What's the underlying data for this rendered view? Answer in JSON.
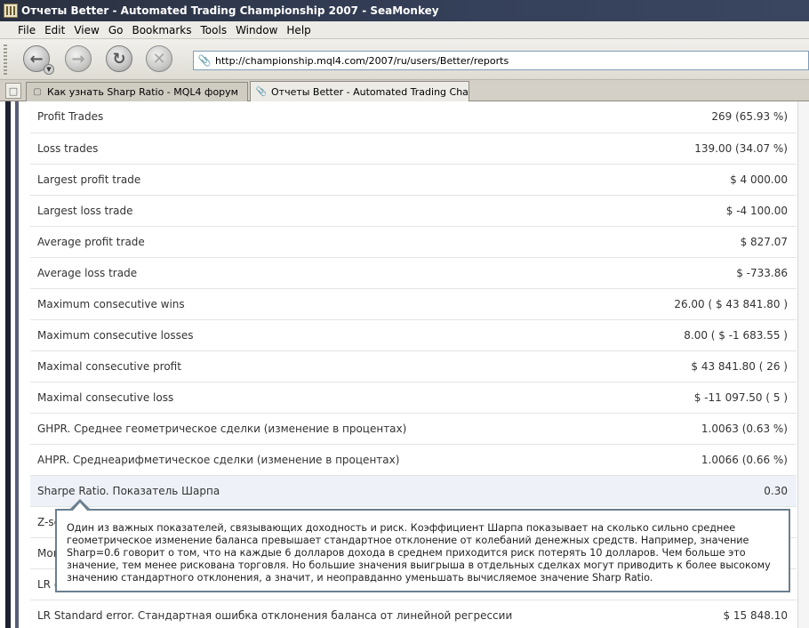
{
  "window": {
    "title": "Отчеты Better - Automated Trading Championship 2007 - SeaMonkey"
  },
  "menu": [
    "File",
    "Edit",
    "View",
    "Go",
    "Bookmarks",
    "Tools",
    "Window",
    "Help"
  ],
  "nav": {
    "back_icon": "back-arrow-icon",
    "forward_icon": "forward-arrow-icon",
    "reload_icon": "reload-icon",
    "stop_icon": "stop-icon",
    "url": "http://championship.mql4.com/2007/ru/users/Better/reports"
  },
  "tabs": [
    {
      "label": "Как узнать Sharp Ratio - MQL4 форум",
      "active": false
    },
    {
      "label": "Отчеты Better - Automated Trading Cham...",
      "active": true
    }
  ],
  "stats": [
    {
      "label": "Profit Trades",
      "value": "269 (65.93 %)"
    },
    {
      "label": "Loss trades",
      "value": "139.00 (34.07 %)"
    },
    {
      "label": "Largest profit trade",
      "value": "$ 4 000.00"
    },
    {
      "label": "Largest loss trade",
      "value": "$ -4 100.00"
    },
    {
      "label": "Average profit trade",
      "value": "$ 827.07"
    },
    {
      "label": "Average loss trade",
      "value": "$ -733.86"
    },
    {
      "label": "Maximum consecutive wins",
      "value": "26.00 ( $ 43 841.80 )"
    },
    {
      "label": "Maximum consecutive losses",
      "value": "8.00 ( $ -1 683.55 )"
    },
    {
      "label": "Maximal consecutive profit",
      "value": "$ 43 841.80 ( 26 )"
    },
    {
      "label": "Maximal consecutive loss",
      "value": "$ -11 097.50 ( 5 )"
    },
    {
      "label": "GHPR. Среднее геометрическое сделки (изменение в процентах)",
      "value": "1.0063 (0.63 %)"
    },
    {
      "label": "AHPR. Среднеарифметическое сделки (изменение в процентах)",
      "value": "1.0066 (0.66 %)"
    },
    {
      "label": "Sharpe Ratio. Показатель Шарпа",
      "value": "0.30"
    },
    {
      "label": "Z-sc",
      "value": ""
    },
    {
      "label": "Mon",
      "value": ""
    },
    {
      "label": "LR c",
      "value": ""
    },
    {
      "label": "LR Standard error. Стандартная ошибка отклонения баланса от линейной регрессии",
      "value": "$ 15 848.10"
    }
  ],
  "tooltip": {
    "text": "Один из важных показателей, связывающих доходность и риск. Коэффициент Шарпа показывает на сколько сильно среднее геометрическое изменение баланса превышает стандартное отклонение от колебаний денежных средств. Например, значение Sharp=0.6 говорит о том, что на каждые 6 долларов дохода в среднем приходится риск потерять 10 долларов. Чем больше это значение, тем менее рискована торговля. Но большие значения выигрыша в отдельных сделках могут приводить к более высокому значению стандартного отклонения, а значит, и неоправданно уменьшать вычисляемое значение Sharp Ratio."
  }
}
